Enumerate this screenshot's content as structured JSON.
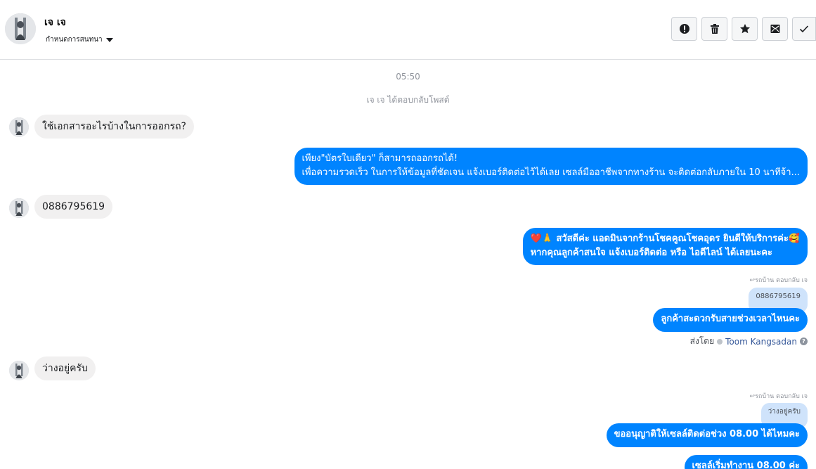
{
  "header": {
    "contact_name": "เจ เจ",
    "label_action": "กำหนดการสนทนา"
  },
  "toolbar": {
    "icons": [
      "alert-icon",
      "trash-icon",
      "star-icon",
      "mark-unread-icon",
      "check-icon"
    ]
  },
  "thread": {
    "timestamp": "05:50",
    "notice": "เจ เจ ได้ตอบกลับโพสต์",
    "msg1": "ใช้เอกสารอะไรบ้างในการออกรถ?",
    "reply1_line1": "เพียง\"บัตรใบเดียว\" ก็สามารถออกรถได้!",
    "reply1_line2": "เพื่อความรวดเร็ว ในการให้ข้อมูลที่ชัดเจน แจ้งเบอร์ติดต่อไว้ได้เลย เซลล์มืออาชีพจากทางร้าน จะติดต่อกลับภายใน 10 นาทีจ้า...",
    "msg2": "0886795619",
    "reply2_line1": "❤️🙏 สวัสดีค่ะ แอดมินจากร้านโชคคูณโชคอุดร ยินดีให้บริการค่ะ🥰",
    "reply2_line2": "หากคุณลูกค้าสนใจ แจ้งเบอร์ติดต่อ หรือ ไอดีไลน์ ได้เลยนะคะ",
    "reply_to_label_1": "↩รถบ้าน ตอบกลับ เจ",
    "quoted_1": "0886795619",
    "reply3": "ลูกค้าสะดวกรับสายช่วงเวลาไหนคะ",
    "sent_by_prefix": "ส่งโดย",
    "sent_by_agent": "Toom Kangsadan",
    "msg3": "ว่างอยู่ครับ",
    "reply_to_label_2": "↩รถบ้าน ตอบกลับ เจ",
    "quoted_2": "ว่างอยู่ครับ",
    "reply4": "ขออนุญาติให้เซลล์ติดต่อช่วง 08.00 ได้ไหมคะ",
    "reply5_partial": "เซลล์เริ่มทำงาน 08.00 ค่ะ"
  },
  "colors": {
    "outgoing_bubble": "#0084ff",
    "incoming_bubble": "#f1f0f0",
    "quoted_bubble": "#cfe3fb",
    "muted_text": "#90949c"
  }
}
